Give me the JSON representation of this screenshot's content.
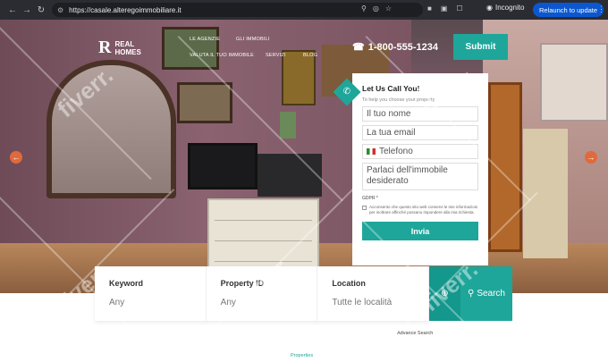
{
  "browser": {
    "url": "https://casale.alteregoimmobiliare.it",
    "incognito_label": "Incognito",
    "relaunch_label": "Relaunch to update"
  },
  "site": {
    "logo_text_line1": "REAL",
    "logo_text_line2": "HOMES",
    "nav": [
      "LE AGENZIE",
      "GLI IMMOBILI",
      "VALUTA IL TUO IMMOBILE",
      "SERVIZI",
      "BLOG"
    ],
    "phone": "1-800-555-1234",
    "submit_label": "Submit"
  },
  "contact_form": {
    "title": "Let Us Call You!",
    "subtitle": "To help you choose your property",
    "name_placeholder": "Il tuo nome",
    "email_placeholder": "La tua email",
    "phone_placeholder": "Telefono",
    "message_placeholder": "Parlaci dell'immobile desiderato",
    "gdpr_label": "GDPR *",
    "gdpr_text": "Acconsento che questo sito web conservi le mie informazioni per inoltrare affinché possano rispondere alla mia richiesta.",
    "send_label": "Invia"
  },
  "search": {
    "keyword_label": "Keyword",
    "keyword_value": "Any",
    "property_id_label": "Property ID",
    "property_id_value": "Any",
    "location_label": "Location",
    "location_value": "Tutte le località",
    "search_label": "Search",
    "advance_label": "Advance Search"
  },
  "footer": {
    "properties_label": "Properties"
  },
  "watermark": {
    "text": "fiverr."
  }
}
